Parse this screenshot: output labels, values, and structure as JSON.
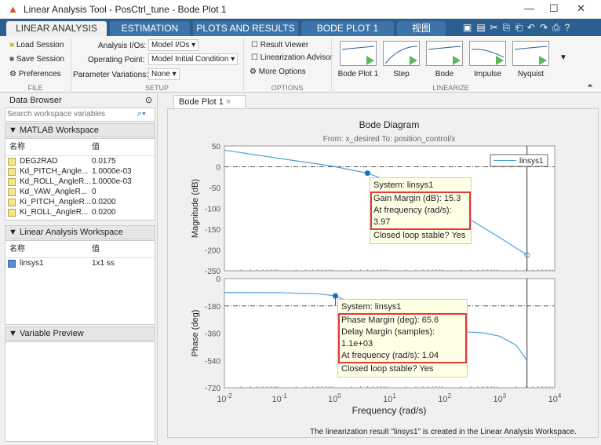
{
  "window": {
    "title": "Linear Analysis Tool - PosCtrl_tune - Bode Plot 1",
    "minimize": "—",
    "maximize": "☐",
    "close": "✕"
  },
  "tabs": [
    {
      "label": "LINEAR ANALYSIS"
    },
    {
      "label": "ESTIMATION"
    },
    {
      "label": "PLOTS AND RESULTS"
    },
    {
      "label": "BODE PLOT 1"
    },
    {
      "label": "视图"
    }
  ],
  "ribbon": {
    "file": {
      "label": "FILE",
      "load": "Load Session",
      "save": "Save Session",
      "prefs": "Preferences"
    },
    "setup": {
      "label": "SETUP",
      "analysis_ios_label": "Analysis I/Os:",
      "analysis_ios_value": "Model I/Os",
      "op_label": "Operating Point:",
      "op_value": "Model Initial Condition",
      "pv_label": "Parameter Variations:",
      "pv_value": "None"
    },
    "options": {
      "label": "OPTIONS",
      "result_viewer": "Result Viewer",
      "lin_advisor": "Linearization Advisor",
      "more": "More Options"
    },
    "linearize": {
      "label": "LINEARIZE",
      "plots": [
        "Bode Plot 1",
        "Step",
        "Bode",
        "Impulse",
        "Nyquist"
      ]
    }
  },
  "data_browser": {
    "title": "Data Browser",
    "search_placeholder": "Search workspace variables",
    "matlab_ws": {
      "title": "MATLAB Workspace",
      "col_name": "名称",
      "col_value": "值",
      "rows": [
        {
          "name": "DEG2RAD",
          "value": "0.0175"
        },
        {
          "name": "Kd_PITCH_Angle...",
          "value": "1.0000e-03"
        },
        {
          "name": "Kd_ROLL_AngleR...",
          "value": "1.0000e-03"
        },
        {
          "name": "Kd_YAW_AngleR...",
          "value": "0"
        },
        {
          "name": "Ki_PITCH_AngleR...",
          "value": "0.0200"
        },
        {
          "name": "Ki_ROLL_AngleR...",
          "value": "0.0200"
        }
      ]
    },
    "lin_ws": {
      "title": "Linear Analysis Workspace",
      "col_name": "名称",
      "col_value": "值",
      "rows": [
        {
          "name": "linsys1",
          "value": "1x1 ss"
        }
      ]
    },
    "var_preview": {
      "title": "Variable Preview"
    }
  },
  "doc_tab": {
    "label": "Bode Plot 1"
  },
  "status": "The linearization result \"linsys1\" is created in the Linear Analysis Workspace.",
  "chart_data": {
    "type": "line",
    "title": "Bode Diagram",
    "subtitle": "From: x_desired  To: position_control/x",
    "xlabel": "Frequency  (rad/s)",
    "xscale": "log",
    "xlim": [
      0.01,
      10000
    ],
    "xticks": [
      "10^-2",
      "10^-1",
      "10^0",
      "10^1",
      "10^2",
      "10^3",
      "10^4"
    ],
    "legend": {
      "entries": [
        "linsys1"
      ],
      "position": "top-right"
    },
    "color": "#4aa3df",
    "nyquist_line": 3141,
    "magnitude": {
      "ylabel": "Magnitude (dB)",
      "ylim": [
        -250,
        50
      ],
      "yticks": [
        50,
        0,
        -50,
        -100,
        -150,
        -200,
        -250
      ],
      "x": [
        0.01,
        0.1,
        1,
        1.04,
        3.97,
        10,
        100,
        1000,
        3141
      ],
      "y": [
        40,
        20,
        1,
        0,
        -15.3,
        -35,
        -90,
        -170,
        -212
      ]
    },
    "phase": {
      "ylabel": "Phase (deg)",
      "ylim": [
        -720,
        0
      ],
      "yticks": [
        0,
        -180,
        -360,
        -540,
        -720
      ],
      "x": [
        0.01,
        0.1,
        0.5,
        1.04,
        2,
        5,
        10,
        50,
        200,
        500,
        1000,
        2000,
        3141
      ],
      "y": [
        -92,
        -93,
        -100,
        -114,
        -160,
        -260,
        -310,
        -345,
        -350,
        -358,
        -380,
        -440,
        -540
      ]
    },
    "gm_tip": {
      "system": "System: linsys1",
      "gm": "Gain Margin (dB): 15.3",
      "freq": "At frequency (rad/s): 3.97",
      "stable": "Closed loop stable? Yes"
    },
    "pm_tip": {
      "system": "System: linsys1",
      "pm": "Phase Margin (deg): 65.6",
      "dm": "Delay Margin (samples): 1.1e+03",
      "freq": "At frequency (rad/s): 1.04",
      "stable": "Closed loop stable? Yes"
    }
  }
}
